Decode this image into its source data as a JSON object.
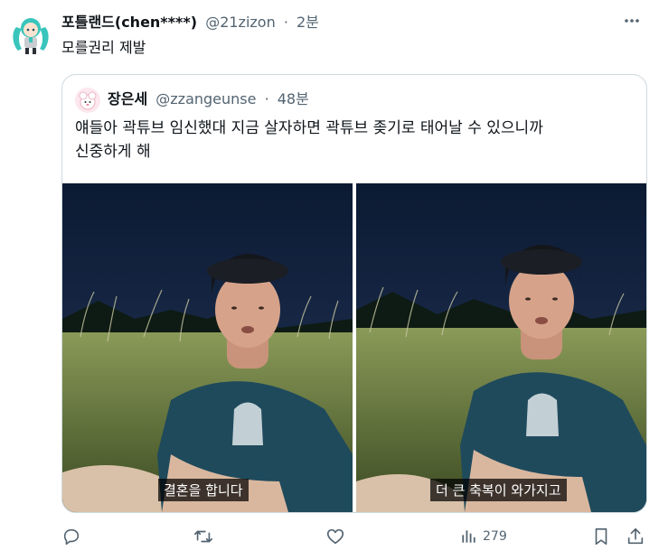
{
  "tweet": {
    "display_name": "포틀랜드(chen****)",
    "handle": "@21zizon",
    "time": "2분",
    "text": "모를권리 제발",
    "more_icon": "more-horizontal-icon"
  },
  "quoted": {
    "display_name": "장은세",
    "handle": "@zzangeunse",
    "time": "48분",
    "text_line1": "얘들아 곽튜브 임신했대 지금 살자하면 곽튜브 좆기로 태어날 수 있으니까",
    "text_line2": "신중하게 해",
    "media": [
      {
        "caption": "결혼을 합니다"
      },
      {
        "caption": "더 큰 축복이 와가지고"
      }
    ]
  },
  "actions": {
    "reply_icon": "reply-icon",
    "retweet_icon": "retweet-icon",
    "like_icon": "heart-icon",
    "views_icon": "views-chart-icon",
    "views_count": "279",
    "bookmark_icon": "bookmark-icon",
    "share_icon": "share-icon"
  },
  "colors": {
    "text": "#0f1419",
    "secondary": "#536471",
    "border": "#cfd9de"
  }
}
